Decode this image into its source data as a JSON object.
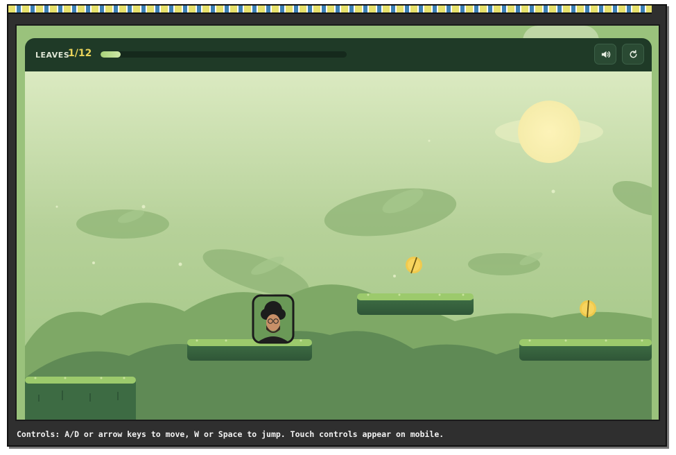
{
  "hud": {
    "leaves_label": "LEAVES",
    "leaves_count": "1/12",
    "collected": 1,
    "total": 12,
    "progress_fraction": 0.083
  },
  "buttons": {
    "sound_icon": "speaker-icon",
    "restart_icon": "restart-icon"
  },
  "footer": {
    "controls_text": "Controls: A/D or arrow keys to move, W or Space to jump. Touch controls appear on mobile."
  },
  "colors": {
    "frame": "#2f2f2f",
    "hud_bg": "#1f3a27",
    "accent_yellow": "#e9d35a",
    "sky_top": "#d9e9bf",
    "grass": "#8fbf63"
  }
}
